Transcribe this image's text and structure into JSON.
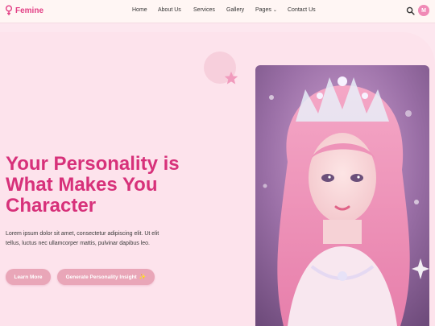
{
  "brand": {
    "name": "Femine",
    "color": "#e23e84"
  },
  "nav": {
    "home": "Home",
    "about": "About Us",
    "services": "Services",
    "gallery": "Gallery",
    "pages": "Pages",
    "contact": "Contact Us"
  },
  "user": {
    "avatar_initial": "M"
  },
  "hero": {
    "title": "Your Personality is What Makes You Character",
    "description": "Lorem ipsum dolor sit amet, consectetur adipiscing elit. Ut elit tellus, luctus nec ullamcorper mattis, pulvinar dapibus leo.",
    "learn_more": "Learn More",
    "generate": "Generate Personality Insight",
    "generate_icon": "sparkles-icon"
  },
  "colors": {
    "accent": "#d7317a",
    "button": "#e9a6b8",
    "background": "#fde7ef"
  }
}
